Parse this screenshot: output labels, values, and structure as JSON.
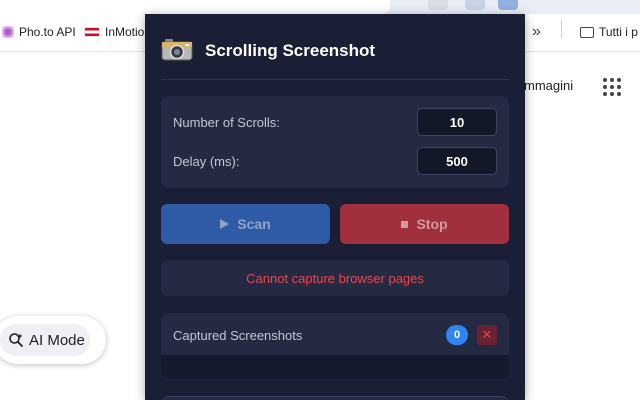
{
  "browser": {
    "bookmarks": [
      {
        "label": "Pho.to API"
      },
      {
        "label": "InMotio"
      },
      {
        "label": "Tutti i p"
      }
    ],
    "overflow_glyph": "»"
  },
  "page": {
    "immagini_link": "mmagini",
    "ai_mode_label": "AI Mode"
  },
  "popup": {
    "title": "Scrolling Screenshot",
    "settings": {
      "scrolls_label": "Number of Scrolls:",
      "scrolls_value": "10",
      "delay_label": "Delay (ms):",
      "delay_value": "500"
    },
    "buttons": {
      "scan_label": "Scan",
      "stop_label": "Stop"
    },
    "status_message": "Cannot capture browser pages",
    "captured": {
      "label": "Captured Screenshots",
      "count": "0",
      "clear_glyph": "✕"
    }
  },
  "colors": {
    "popup_bg": "#1a1f35",
    "card_bg": "#232a42",
    "scan_button": "#2f5aa5",
    "stop_button": "#a12f3d",
    "error_text": "#f0444f",
    "count_badge": "#2f86f0"
  }
}
